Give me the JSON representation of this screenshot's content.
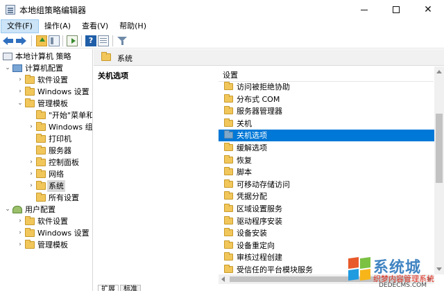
{
  "window": {
    "title": "本地组策略编辑器",
    "controls": {
      "minimize": "—",
      "maximize": "☐",
      "close": "✕"
    }
  },
  "menu": [
    "文件(F)",
    "操作(A)",
    "查看(V)",
    "帮助(H)"
  ],
  "toolbar": {
    "help_glyph": "?",
    "icons": [
      "back-icon",
      "forward-icon",
      "up-folder-icon",
      "show-tree-icon",
      "export-list-icon",
      "help-icon",
      "properties-icon",
      "filter-icon"
    ]
  },
  "tree": [
    {
      "label": "本地计算机 策略",
      "level": 0,
      "expanded": true,
      "icon": "policy"
    },
    {
      "label": "计算机配置",
      "level": 1,
      "expanded": true,
      "icon": "computer"
    },
    {
      "label": "软件设置",
      "level": 2,
      "expanded": false,
      "icon": "folder"
    },
    {
      "label": "Windows 设置",
      "level": 2,
      "expanded": false,
      "icon": "folder"
    },
    {
      "label": "管理模板",
      "level": 2,
      "expanded": true,
      "icon": "folder"
    },
    {
      "label": "\"开始\"菜单和",
      "level": 3,
      "expanded": null,
      "icon": "folder"
    },
    {
      "label": "Windows 组",
      "level": 3,
      "expanded": false,
      "icon": "folder"
    },
    {
      "label": "打印机",
      "level": 3,
      "expanded": null,
      "icon": "folder"
    },
    {
      "label": "服务器",
      "level": 3,
      "expanded": null,
      "icon": "folder"
    },
    {
      "label": "控制面板",
      "level": 3,
      "expanded": false,
      "icon": "folder"
    },
    {
      "label": "网络",
      "level": 3,
      "expanded": false,
      "icon": "folder"
    },
    {
      "label": "系统",
      "level": 3,
      "expanded": false,
      "icon": "folder",
      "selected": true
    },
    {
      "label": "所有设置",
      "level": 3,
      "expanded": null,
      "icon": "folder"
    },
    {
      "label": "用户配置",
      "level": 1,
      "expanded": true,
      "icon": "users"
    },
    {
      "label": "软件设置",
      "level": 2,
      "expanded": false,
      "icon": "folder"
    },
    {
      "label": "Windows 设置",
      "level": 2,
      "expanded": false,
      "icon": "folder"
    },
    {
      "label": "管理模板",
      "level": 2,
      "expanded": false,
      "icon": "folder"
    }
  ],
  "right": {
    "header_title": "系统",
    "description_title": "关机选项",
    "column_header": "设置",
    "items": [
      "访问被拒绝协助",
      "分布式 COM",
      "服务器管理器",
      "关机",
      "关机选项",
      "缓解选项",
      "恢复",
      "脚本",
      "可移动存储访问",
      "凭据分配",
      "区域设置服务",
      "驱动程序安装",
      "设备安装",
      "设备重定向",
      "审核过程创建",
      "受信任的平台模块服务"
    ],
    "selected_item": "关机选项",
    "tabs": [
      "扩展",
      "标准"
    ]
  },
  "watermark": {
    "brand": "系统城",
    "subtitle": "织梦内容管理系统",
    "url": "DEDECMS.COM"
  },
  "colors": {
    "selection": "#0078d7",
    "folder": "#f1c65b",
    "header_bg": "#f1f1f1"
  }
}
